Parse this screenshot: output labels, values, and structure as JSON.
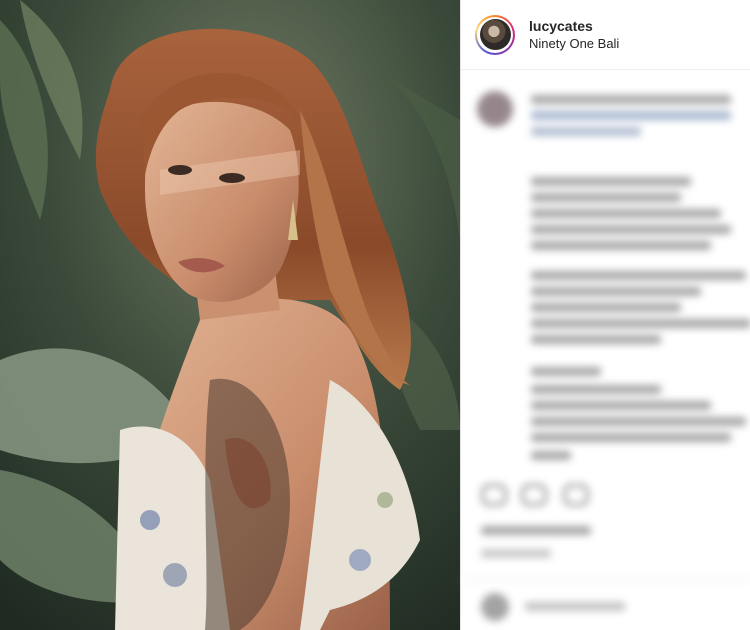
{
  "post": {
    "username": "lucycates",
    "location": "Ninety One Bali"
  },
  "colors": {
    "story_ring_start": "#f58529",
    "story_ring_end": "#515bd4",
    "text": "#262626"
  },
  "icons": [
    "avatar",
    "like-icon",
    "comment-icon",
    "share-icon"
  ]
}
